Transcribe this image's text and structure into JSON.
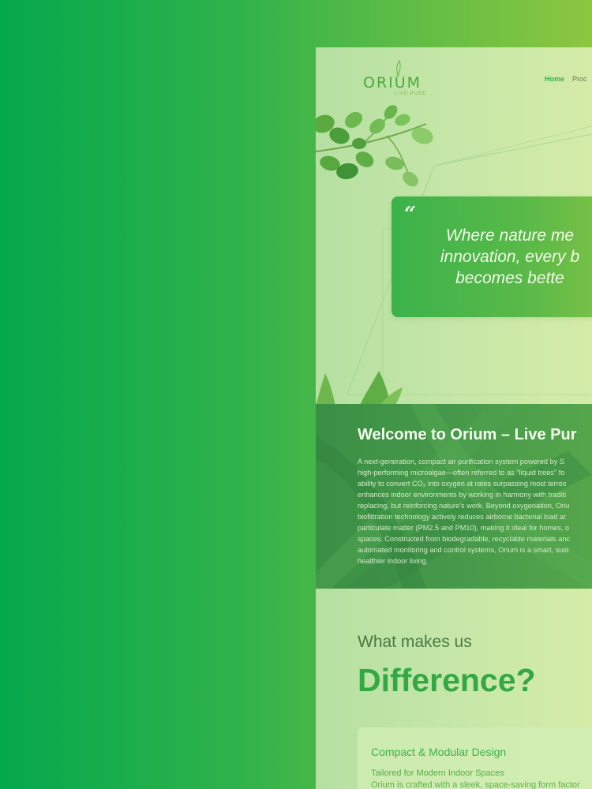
{
  "brand": {
    "name": "ORIUM",
    "tagline": "LIVE PURE",
    "color": "#4aa93f"
  },
  "nav": {
    "items": [
      {
        "label": "Home",
        "active": true
      },
      {
        "label": "Proc",
        "active": false
      }
    ]
  },
  "quote": {
    "mark": "“",
    "text": "Where nature me\ninnovation, every b\nbecomes bette"
  },
  "welcome": {
    "title": "Welcome to  Orium – Live Pur",
    "lines": [
      "A next-generation, compact air purification system powered by S",
      "high-performing microalgae—often referred to as \"liquid trees\" fo",
      "ability to convert CO₂ into oxygen at rates surpassing most terres",
      "enhances indoor environments by working in harmony with traditi",
      "replacing, but reinforcing nature's work. Beyond oxygenation, Oriu",
      "biofiltration technology actively reduces airborne bacterial load ar",
      "particulate matter (PM2.5 and PM10), making it ideal for homes, o",
      "spaces. Constructed from biodegradable, recyclable materials anc",
      "automated monitoring and control systems, Orium is a smart, sust",
      "healthier indoor living."
    ]
  },
  "difference": {
    "subtitle": "What makes us",
    "title": "Difference?"
  },
  "feature": {
    "title": "Compact & Modular Design",
    "subtitle": "Tailored for Modern Indoor Spaces",
    "description": "Orium is crafted with a sleek, space-saving form factor"
  },
  "colors": {
    "outer_gradient_start": "#05a84c",
    "outer_gradient_end": "#8cc63f",
    "accent": "#33b14a",
    "welcome_band": "#479a4a"
  }
}
